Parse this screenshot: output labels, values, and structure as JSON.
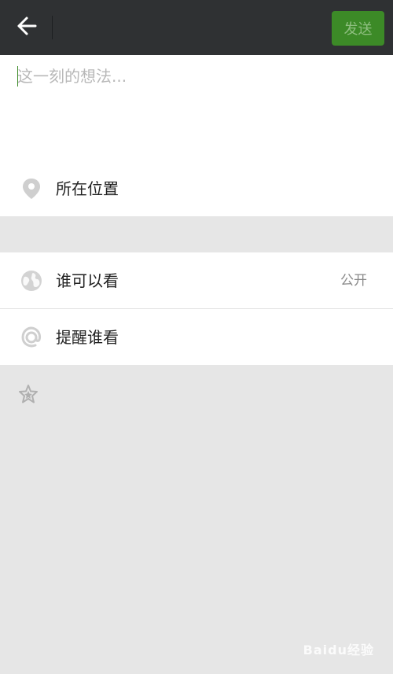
{
  "header": {
    "back_icon": "arrow-left-icon",
    "send_label": "发送",
    "colors": {
      "bar": "#2f3133",
      "send_bg": "#3c8a27",
      "send_text": "#8fbf80"
    }
  },
  "compose": {
    "placeholder": "这一刻的想法...",
    "value": ""
  },
  "location": {
    "icon": "location-pin-icon",
    "label": "所在位置"
  },
  "settings": {
    "visibility": {
      "icon": "globe-icon",
      "label": "谁可以看",
      "value": "公开"
    },
    "mention": {
      "icon": "at-icon",
      "label": "提醒谁看"
    }
  },
  "favorite": {
    "icon": "star-icon"
  },
  "watermark": {
    "text": "Baidu经验"
  }
}
